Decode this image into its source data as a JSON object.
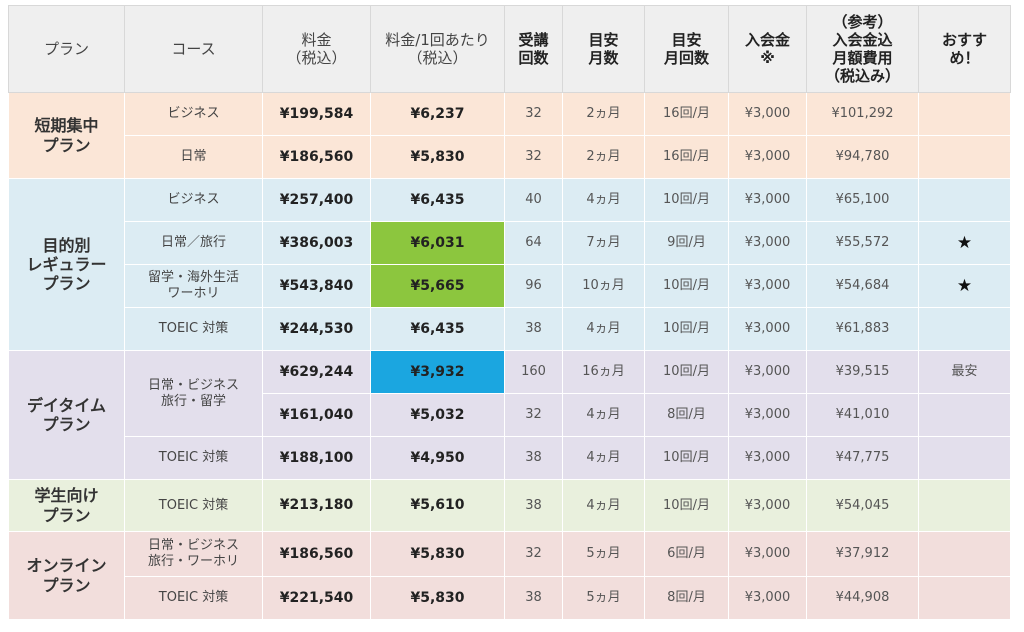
{
  "headers": {
    "plan": "プラン",
    "course": "コース",
    "fee": "料金\n（税込）",
    "fee_per": "料金/1回あたり\n（税込）",
    "lessons": "受講\n回数",
    "months": "目安\n月数",
    "monthly_times": "目安\n月回数",
    "admission": "入会金\n※",
    "monthly_ref": "（参考）\n入会金込\n月額費用\n（税込み）",
    "recommend": "おすす\nめ！"
  },
  "plans": [
    {
      "name": "短期集中\nプラン",
      "color": "#fbe6d7",
      "rows": [
        {
          "course": "ビジネス",
          "fee": "¥199,584",
          "per": "¥6,237",
          "lessons": "32",
          "months": "2ヵ月",
          "monthly": "16回/月",
          "admission": "¥3,000",
          "ref": "¥101,292",
          "rec": ""
        },
        {
          "course": "日常",
          "fee": "¥186,560",
          "per": "¥5,830",
          "lessons": "32",
          "months": "2ヵ月",
          "monthly": "16回/月",
          "admission": "¥3,000",
          "ref": "¥94,780",
          "rec": ""
        }
      ]
    },
    {
      "name": "目的別\nレギュラー\nプラン",
      "color": "#dcecf3",
      "rows": [
        {
          "course": "ビジネス",
          "fee": "¥257,400",
          "per": "¥6,435",
          "lessons": "40",
          "months": "4ヵ月",
          "monthly": "10回/月",
          "admission": "¥3,000",
          "ref": "¥65,100",
          "rec": ""
        },
        {
          "course": "日常／旅行",
          "fee": "¥386,003",
          "per": "¥6,031",
          "lessons": "64",
          "months": "7ヵ月",
          "monthly": "9回/月",
          "admission": "¥3,000",
          "ref": "¥55,572",
          "rec": "★",
          "highlight": "green"
        },
        {
          "course": "留学・海外生活\nワーホリ",
          "fee": "¥543,840",
          "per": "¥5,665",
          "lessons": "96",
          "months": "10ヵ月",
          "monthly": "10回/月",
          "admission": "¥3,000",
          "ref": "¥54,684",
          "rec": "★",
          "highlight": "green"
        },
        {
          "course": "TOEIC 対策",
          "fee": "¥244,530",
          "per": "¥6,435",
          "lessons": "38",
          "months": "4ヵ月",
          "monthly": "10回/月",
          "admission": "¥3,000",
          "ref": "¥61,883",
          "rec": ""
        }
      ]
    },
    {
      "name": "デイタイム\nプラン",
      "color": "#e3dfec",
      "rows": [
        {
          "course": "日常・ビジネス\n旅行・留学",
          "course_rowspan": 2,
          "fee": "¥629,244",
          "per": "¥3,932",
          "lessons": "160",
          "months": "16ヵ月",
          "monthly": "10回/月",
          "admission": "¥3,000",
          "ref": "¥39,515",
          "rec": "最安",
          "highlight": "blue"
        },
        {
          "course": null,
          "fee": "¥161,040",
          "per": "¥5,032",
          "lessons": "32",
          "months": "4ヵ月",
          "monthly": "8回/月",
          "admission": "¥3,000",
          "ref": "¥41,010",
          "rec": ""
        },
        {
          "course": "TOEIC 対策",
          "fee": "¥188,100",
          "per": "¥4,950",
          "lessons": "38",
          "months": "4ヵ月",
          "monthly": "10回/月",
          "admission": "¥3,000",
          "ref": "¥47,775",
          "rec": ""
        }
      ]
    },
    {
      "name": "学生向け\nプラン",
      "color": "#e9f0dd",
      "rows": [
        {
          "course": "TOEIC 対策",
          "fee": "¥213,180",
          "per": "¥5,610",
          "lessons": "38",
          "months": "4ヵ月",
          "monthly": "10回/月",
          "admission": "¥3,000",
          "ref": "¥54,045",
          "rec": ""
        }
      ]
    },
    {
      "name": "オンライン\nプラン",
      "color": "#f2dedc",
      "rows": [
        {
          "course": "日常・ビジネス\n旅行・ワーホリ",
          "fee": "¥186,560",
          "per": "¥5,830",
          "lessons": "32",
          "months": "5ヵ月",
          "monthly": "6回/月",
          "admission": "¥3,000",
          "ref": "¥37,912",
          "rec": ""
        },
        {
          "course": "TOEIC 対策",
          "fee": "¥221,540",
          "per": "¥5,830",
          "lessons": "38",
          "months": "5ヵ月",
          "monthly": "8回/月",
          "admission": "¥3,000",
          "ref": "¥44,908",
          "rec": ""
        }
      ]
    }
  ]
}
